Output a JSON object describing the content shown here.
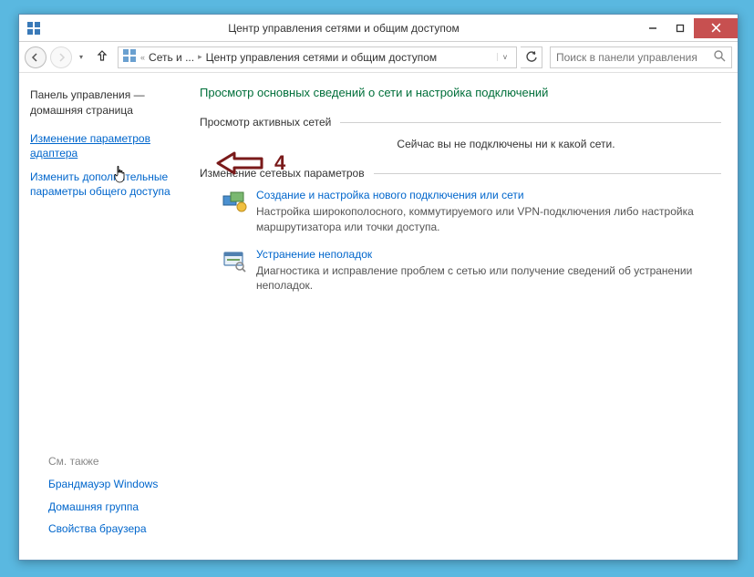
{
  "titlebar": {
    "title": "Центр управления сетями и общим доступом"
  },
  "nav": {
    "crumb1": "Сеть и ...",
    "crumb2": "Центр управления сетями и общим доступом",
    "search_placeholder": "Поиск в панели управления"
  },
  "sidebar": {
    "heading": "Панель управления — домашняя страница",
    "link_adapter": "Изменение параметров адаптера",
    "link_sharing": "Изменить дополнительные параметры общего доступа",
    "footer_title": "См. также",
    "footer_firewall": "Брандмауэр Windows",
    "footer_homegroup": "Домашняя группа",
    "footer_browser": "Свойства браузера"
  },
  "main": {
    "heading": "Просмотр основных сведений о сети и настройка подключений",
    "active_networks_title": "Просмотр активных сетей",
    "not_connected": "Сейчас вы не подключены ни к какой сети.",
    "net_settings_title": "Изменение сетевых параметров",
    "item1_title": "Создание и настройка нового подключения или сети",
    "item1_desc": "Настройка широкополосного, коммутируемого или VPN-подключения либо настройка маршрутизатора или точки доступа.",
    "item2_title": "Устранение неполадок",
    "item2_desc": "Диагностика и исправление проблем с сетью или получение сведений об устранении неполадок."
  },
  "annotation": {
    "number": "4"
  }
}
